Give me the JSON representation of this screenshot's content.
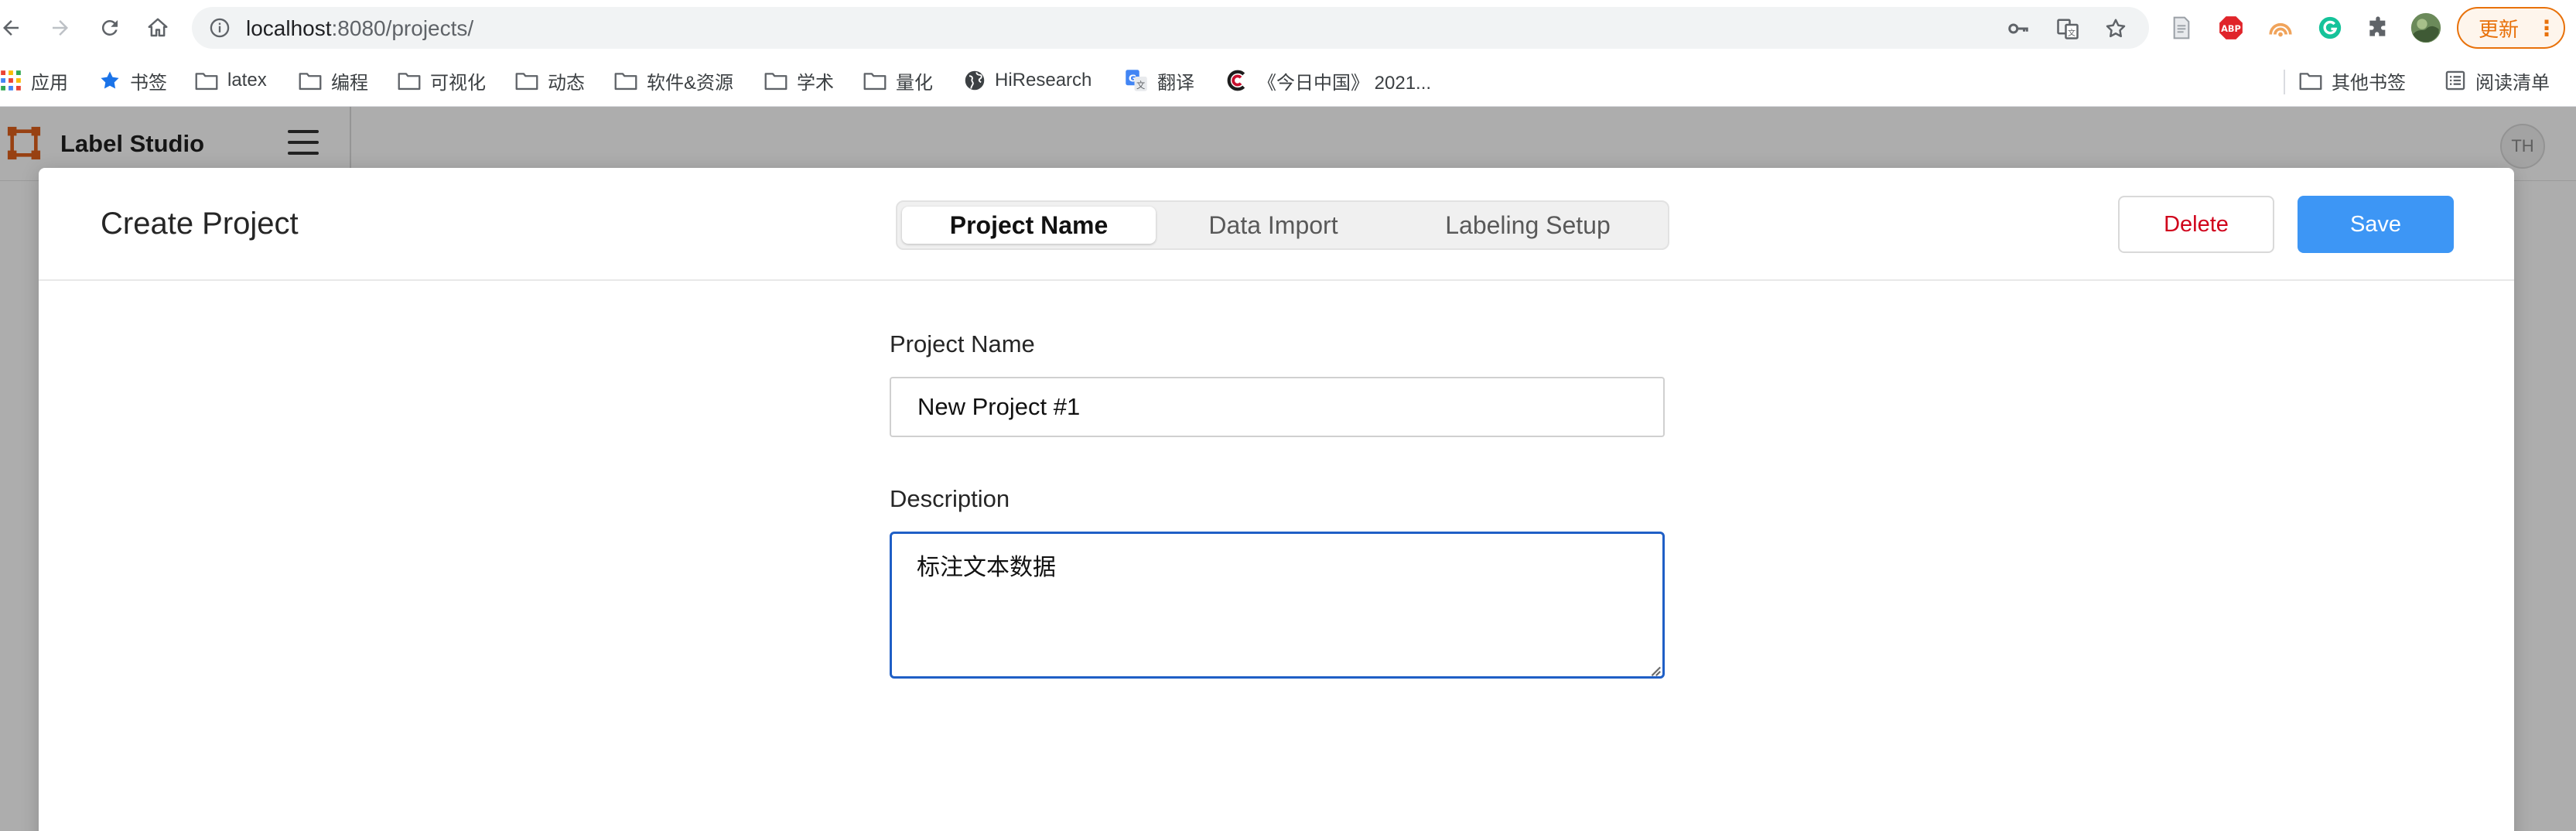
{
  "browser": {
    "url_host": "localhost",
    "url_path": ":8080/projects/",
    "update_label": "更新",
    "bookmarks": [
      {
        "label": "应用",
        "icon": "apps-grid-icon"
      },
      {
        "label": "书签",
        "icon": "star-icon"
      },
      {
        "label": "latex",
        "icon": "folder-icon"
      },
      {
        "label": "编程",
        "icon": "folder-icon"
      },
      {
        "label": "可视化",
        "icon": "folder-icon"
      },
      {
        "label": "动态",
        "icon": "folder-icon"
      },
      {
        "label": "软件&资源",
        "icon": "folder-icon"
      },
      {
        "label": "学术",
        "icon": "folder-icon"
      },
      {
        "label": "量化",
        "icon": "folder-icon"
      },
      {
        "label": "HiResearch",
        "icon": "globe-icon"
      },
      {
        "label": "翻译",
        "icon": "translate-icon"
      },
      {
        "label": "《今日中国》 2021...",
        "icon": "c-logo-icon"
      },
      {
        "label": "其他书签",
        "icon": "folder-icon"
      },
      {
        "label": "阅读清单",
        "icon": "reading-list-icon"
      }
    ]
  },
  "app": {
    "title": "Label Studio",
    "avatar_initials": "TH"
  },
  "modal": {
    "title": "Create Project",
    "tabs": [
      "Project Name",
      "Data Import",
      "Labeling Setup"
    ],
    "active_tab": "Project Name",
    "delete_label": "Delete",
    "save_label": "Save",
    "project_name_label": "Project Name",
    "project_name_value": "New Project #1",
    "description_label": "Description",
    "description_value": "标注文本数据"
  },
  "colors": {
    "primary": "#3d96f5",
    "danger": "#d0021b",
    "focus_border": "#1f5fc6",
    "update_accent": "#e8710a"
  }
}
